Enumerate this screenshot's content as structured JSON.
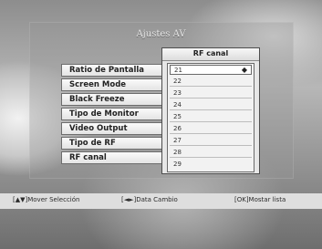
{
  "window": {
    "title": "Ajustes AV"
  },
  "menu": {
    "items": [
      {
        "label": "Ratio de Pantalla"
      },
      {
        "label": "Screen Mode"
      },
      {
        "label": "Black Freeze"
      },
      {
        "label": "Tipo de Monitor"
      },
      {
        "label": "Video Output"
      },
      {
        "label": "Tipo de RF"
      },
      {
        "label": "RF canal"
      }
    ]
  },
  "dropdown": {
    "title": "RF canal",
    "selected": "21",
    "options": [
      "21",
      "22",
      "23",
      "24",
      "25",
      "26",
      "27",
      "28",
      "29"
    ]
  },
  "footer": {
    "hint_move": "[▲▼]Mover Selección",
    "hint_change": "[◄►]Data Cambio",
    "hint_ok": "[OK]Mostar lista"
  }
}
